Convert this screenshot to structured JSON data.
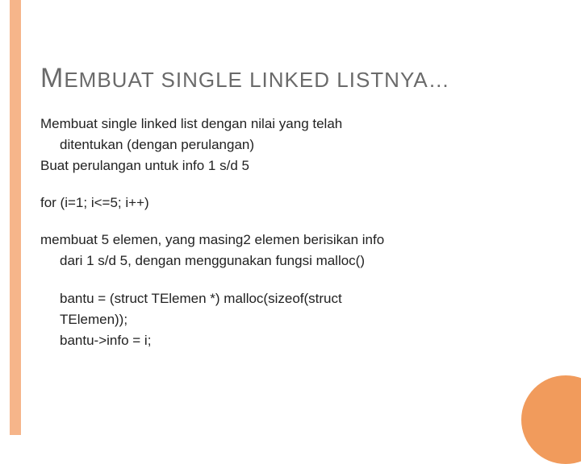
{
  "title": {
    "cap1": "M",
    "rest1": "EMBUAT",
    "word2": " SINGLE",
    "word3": " LINKED",
    "word4": " LISTNYA",
    "dots": "…"
  },
  "lines": {
    "l1": "Membuat single linked list dengan nilai yang telah",
    "l2": "ditentukan (dengan perulangan)",
    "l3": "Buat perulangan untuk info 1 s/d 5",
    "l4": "for (i=1; i<=5; i++)",
    "l5": "membuat 5 elemen, yang masing2 elemen berisikan info",
    "l6": "dari 1 s/d 5, dengan menggunakan fungsi malloc()",
    "l7": "bantu = (struct TElemen *) malloc(sizeof(struct",
    "l8": "TElemen));",
    "l9": "bantu->info = i;"
  }
}
